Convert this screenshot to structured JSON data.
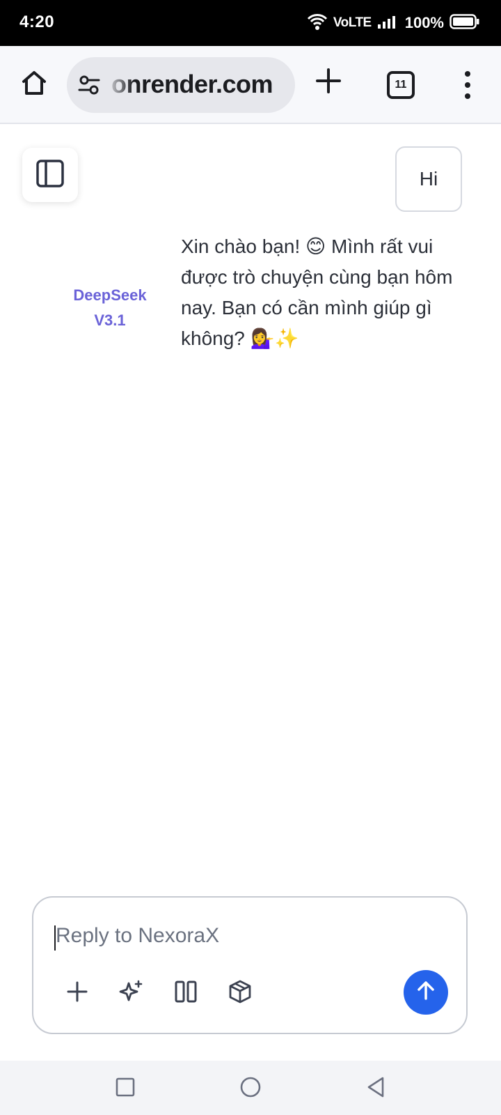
{
  "status_bar": {
    "time": "4:20",
    "volte": "VoLTE",
    "battery_percent": "100%",
    "icons": [
      "wifi-icon",
      "signal-icon",
      "battery-icon"
    ]
  },
  "browser": {
    "url": "onrender.com",
    "tab_count": "11",
    "icons": [
      "home-icon",
      "tune-icon",
      "plus-icon",
      "tabs-icon",
      "more-vert-icon"
    ]
  },
  "chat": {
    "user_message": "Hi",
    "model_name_line1": "DeepSeek",
    "model_name_line2": "V3.1",
    "assistant_message": "Xin chào bạn! 😊 Mình rất vui được trò chuyện cùng bạn hôm nay. Bạn có cần mình giúp gì không? 💁‍♀️✨"
  },
  "composer": {
    "placeholder": "Reply to NexoraX",
    "tools": [
      "add-icon",
      "sparkle-icon",
      "columns-icon",
      "cube-icon"
    ],
    "send_icon": "arrow-up-icon"
  },
  "colors": {
    "accent": "#2563eb",
    "model_label": "#6a62d8",
    "text": "#2b2f38"
  },
  "nav_bar": {
    "icons": [
      "recents-icon",
      "home-circle-icon",
      "back-icon"
    ]
  }
}
